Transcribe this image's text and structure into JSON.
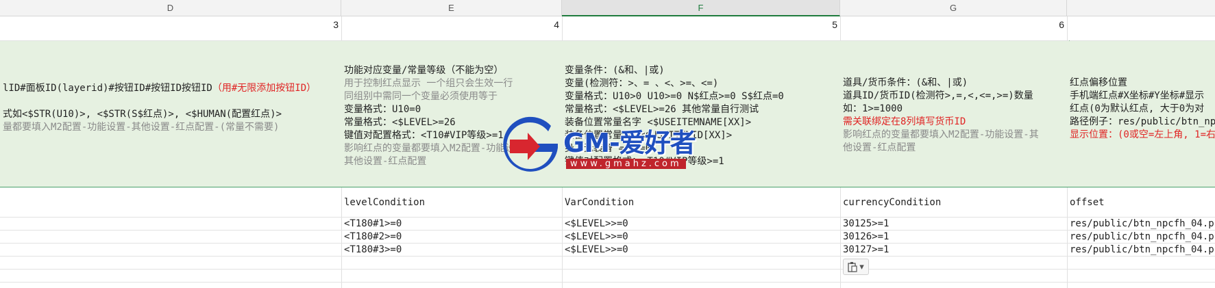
{
  "columns": [
    "D",
    "E",
    "F",
    "G",
    ""
  ],
  "selected_column": "F",
  "row_numbers": [
    "3",
    "4",
    "5",
    "6"
  ],
  "desc": {
    "d": [
      {
        "t": "lID#面板ID(layerid)#按钮ID#按钮ID按钮ID",
        "c": "dark",
        "r": "（用#无限添加按钮ID）"
      },
      {
        "t": "",
        "c": "dark"
      },
      {
        "t": "式如<$STR(U10)>, <$STR(S$红点)>, <$HUMAN(配置红点)>",
        "c": "dark"
      },
      {
        "t": "量都要填入M2配置-功能设置-其他设置-红点配置-(常量不需要)",
        "c": "gray"
      }
    ],
    "e": [
      {
        "t": "功能对应变量/常量等级（不能为空）",
        "c": "dark"
      },
      {
        "t": "用于控制红点显示 一个组只会生效一行",
        "c": "gray"
      },
      {
        "t": "同组别中需同一个变量必须使用等于",
        "c": "gray"
      },
      {
        "t": "变量格式：U10=0",
        "c": "dark"
      },
      {
        "t": "常量格式：<$LEVEL>=26",
        "c": "dark"
      },
      {
        "t": "键值对配置格式：<T10#VIP等级>=1",
        "c": "dark"
      },
      {
        "t": "影响红点的变量都要填入M2配置-功能设置-",
        "c": "gray"
      },
      {
        "t": "其他设置-红点配置",
        "c": "gray"
      }
    ],
    "f": [
      {
        "t": "变量条件：(&和、|或)",
        "c": "dark"
      },
      {
        "t": "变量(检测符：>、= 、<、>=、<=)",
        "c": "dark"
      },
      {
        "t": "变量格式：U10>0  U10>=0  N$红点>=0  S$红点=0",
        "c": "dark"
      },
      {
        "t": "常量格式：<$LEVEL>=26  其他常量自行测试",
        "c": "dark"
      },
      {
        "t": "装备位置常量名字 <$USEITEMNAME[XX]>",
        "c": "dark"
      },
      {
        "t": "装备位置常量ID <$USEITEMID[XX]>",
        "c": "dark"
      },
      {
        "t": "身上无装备 =0或=0",
        "c": "dark"
      },
      {
        "t": "键值对配置格式：<T10#VIP等级>=1",
        "c": "dark"
      }
    ],
    "g": [
      {
        "t": "道具/货币条件：(&和、|或)",
        "c": "dark"
      },
      {
        "t": "道具ID/货币ID(检测符>,=,<,<=,>=)数量",
        "c": "dark"
      },
      {
        "t": "如：1>=1000",
        "c": "dark"
      },
      {
        "t": "需关联绑定在8列填写货币ID",
        "c": "red"
      },
      {
        "t": "影响红点的变量都要填入M2配置-功能设置-其",
        "c": "gray"
      },
      {
        "t": "他设置-红点配置",
        "c": "gray"
      }
    ],
    "h": [
      {
        "t": "红点偏移位置",
        "c": "dark"
      },
      {
        "t": "手机端红点#X坐标#Y坐标#显示",
        "c": "dark"
      },
      {
        "t": "红点(0为默认红点, 大于0为对",
        "c": "dark"
      },
      {
        "t": "路径例子：res/public/btn_np",
        "c": "dark"
      },
      {
        "t": "显示位置：(0或空=左上角, 1=右",
        "c": "red"
      }
    ]
  },
  "fields": {
    "d": "",
    "e": "levelCondition",
    "f": "VarCondition",
    "g": "currencyCondition",
    "h": "offset"
  },
  "rows": [
    {
      "e": "<T180#1>=0",
      "f": "<$LEVEL>>=0",
      "g": "30125>=1",
      "h": "res/public/btn_npcfh_04.png"
    },
    {
      "e": "<T180#2>=0",
      "f": "<$LEVEL>>=0",
      "g": "30126>=1",
      "h": "res/public/btn_npcfh_04.png"
    },
    {
      "e": "<T180#3>=0",
      "f": "<$LEVEL>>=0",
      "g": "30127>=1",
      "h": "res/public/btn_npcfh_04.png"
    }
  ],
  "watermark": {
    "brand": "GM-爱好者",
    "url": "www.gmahz.com"
  },
  "paste_icon": "paste-options-icon",
  "colors": {
    "header_bg": "#f3f3f3",
    "selected_col": "#1e7b3d",
    "desc_bg": "#e6f1e1",
    "red": "#e02424",
    "wm_blue": "#1f4fbf",
    "wm_red": "#c0242c"
  }
}
